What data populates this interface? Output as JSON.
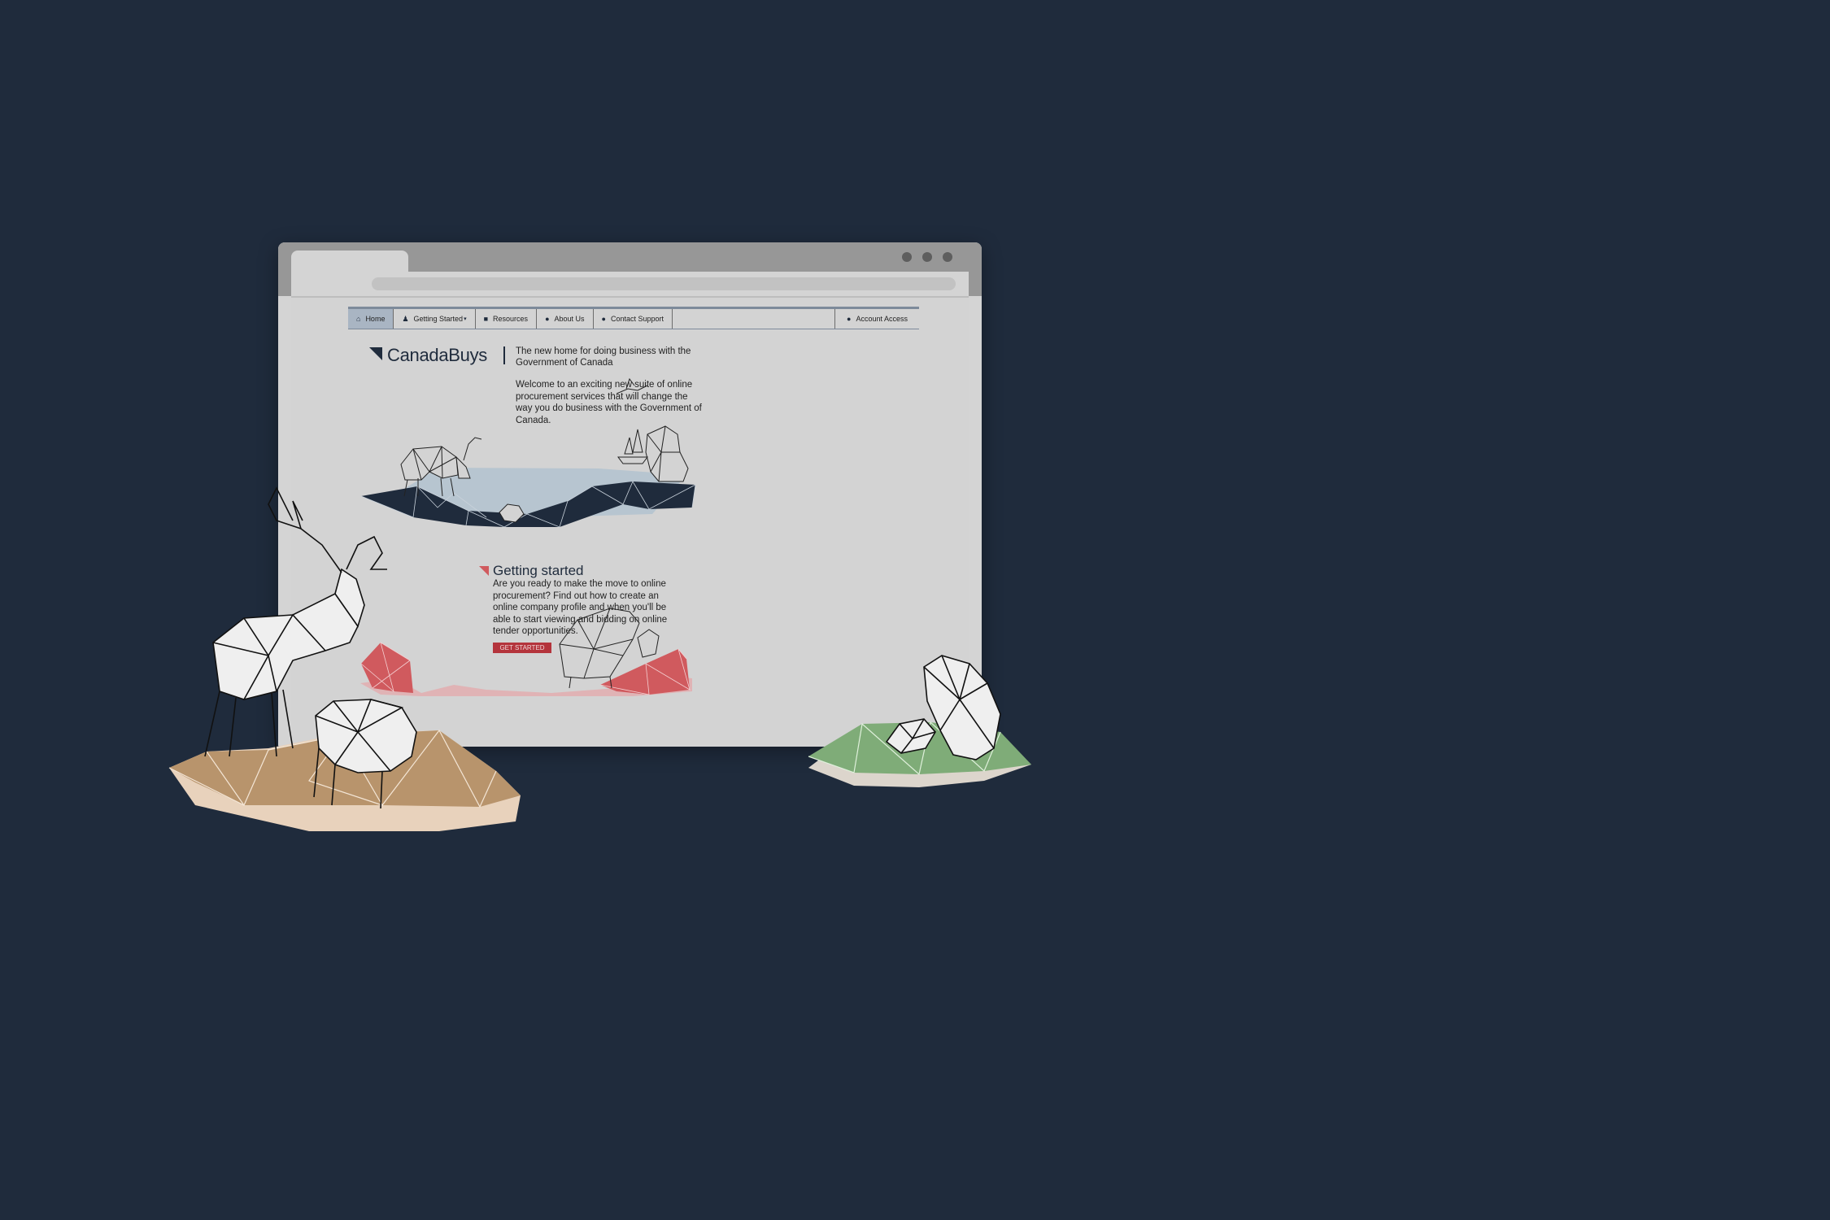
{
  "nav": {
    "items": [
      {
        "label": "Home",
        "icon": "home-icon"
      },
      {
        "label": "Getting Started",
        "icon": "people-icon"
      },
      {
        "label": "Resources",
        "icon": "book-icon"
      },
      {
        "label": "About Us",
        "icon": "info-icon"
      },
      {
        "label": "Contact Support",
        "icon": "help-icon"
      }
    ],
    "account": {
      "label": "Account Access",
      "icon": "user-icon"
    },
    "active": "Home"
  },
  "brand": {
    "name": "CanadaBuys",
    "tagline": "The new home for doing business with the Government of Canada"
  },
  "welcome": "Welcome to an exciting new suite of online procurement services that will change the way you do business with the Government of Canada.",
  "getting_started": {
    "title": "Getting started",
    "body": "Are you ready to make the move to online procurement? Find out how to create an online company profile and when you'll be able to start viewing and bidding on online tender opportunities.",
    "button": "GET STARTED"
  },
  "colors": {
    "background": "#1f2b3c",
    "navy": "#1f2b3c",
    "ice": "#b7c5d0",
    "red": "#d05a5e",
    "button": "#b4343c",
    "sand": "#b8946c",
    "green": "#7fac78"
  }
}
